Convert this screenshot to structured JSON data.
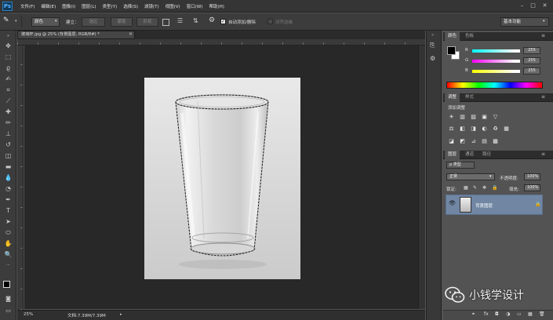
{
  "app": {
    "logo": "Ps"
  },
  "menu": [
    "文件(F)",
    "编辑(E)",
    "图像(I)",
    "图层(L)",
    "类型(Y)",
    "选择(S)",
    "滤镜(T)",
    "视图(V)",
    "窗口(W)",
    "帮助(H)"
  ],
  "window_controls": [
    "–",
    "□",
    "✕"
  ],
  "options": {
    "style": "颜色",
    "refine_label": "建立：",
    "selection_btn": "选区",
    "mask_btn": "蒙版",
    "shape_btn": "形状",
    "auto_add_delete": "自动添加/删除",
    "align_edges": "对齐边缘",
    "workspace": "基本功能"
  },
  "document": {
    "tab_title": "玻璃杯.jpg @ 25% (背景图层, RGB/8#) *",
    "close": "×"
  },
  "status": {
    "zoom": "25%",
    "doc_size": "文档:7.39M/7.39M"
  },
  "color_panel": {
    "tabs": [
      "颜色",
      "色板"
    ],
    "channels": [
      {
        "label": "R",
        "value": "255"
      },
      {
        "label": "G",
        "value": "255"
      },
      {
        "label": "B",
        "value": "255"
      }
    ],
    "colors": {
      "r_gradient": "#ff3b3b",
      "g_gradient": "#38ff38",
      "b_gradient": "#3b6bff",
      "fg": "#000000",
      "bg": "#ffffff"
    }
  },
  "adjust_panel": {
    "tabs": [
      "调整",
      "样式"
    ],
    "title": "添加调整",
    "row1": [
      "☀",
      "▥",
      "▨",
      "▣",
      "▽"
    ],
    "row2": [
      "⚖",
      "◧",
      "◨",
      "◐",
      "♻",
      "▦"
    ],
    "row3": [
      "◪",
      "◩",
      "⊿",
      "▤",
      "▩"
    ]
  },
  "layers_panel": {
    "tabs": [
      "图层",
      "通道",
      "路径"
    ],
    "kind_label": "ρ 类型",
    "blend_mode": "正常",
    "opacity_label": "不透明度:",
    "opacity": "100%",
    "lock_label": "锁定:",
    "fill_label": "填充:",
    "fill": "100%",
    "layers": [
      {
        "name": "背景图层",
        "visible": true,
        "selected": true
      }
    ],
    "footer_icons": [
      "⚭",
      "fx",
      "◘",
      "◑",
      "▭",
      "▦",
      "🗑"
    ]
  },
  "watermark": {
    "text": "小钱学设计"
  },
  "collapse_label": "◂◂"
}
